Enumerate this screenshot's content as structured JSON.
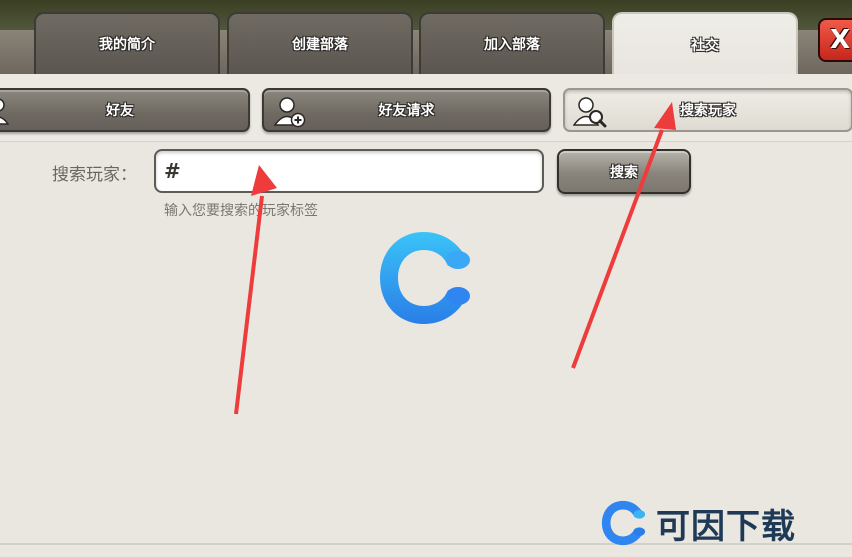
{
  "tabs": [
    {
      "label": "我的简介",
      "active": false
    },
    {
      "label": "创建部落",
      "active": false
    },
    {
      "label": "加入部落",
      "active": false
    },
    {
      "label": "社交",
      "active": true
    }
  ],
  "close_label": "X",
  "subtabs": [
    {
      "label": "好友",
      "icon": "person-icon",
      "active": false
    },
    {
      "label": "好友请求",
      "icon": "add-friend-icon",
      "active": false
    },
    {
      "label": "搜索玩家",
      "icon": "search-player-icon",
      "active": true
    }
  ],
  "search": {
    "label": "搜索玩家：",
    "prefix": "#",
    "value": "",
    "placeholder": "",
    "button_label": "搜索",
    "hint": "输入您要搜索的玩家标签"
  },
  "watermark": {
    "text": "可因下载"
  },
  "colors": {
    "accent_red": "#ee3b3b",
    "logo_blue": "#2f86f0",
    "logo_cyan": "#39b8f6",
    "watermark_text": "#1f3a57"
  }
}
